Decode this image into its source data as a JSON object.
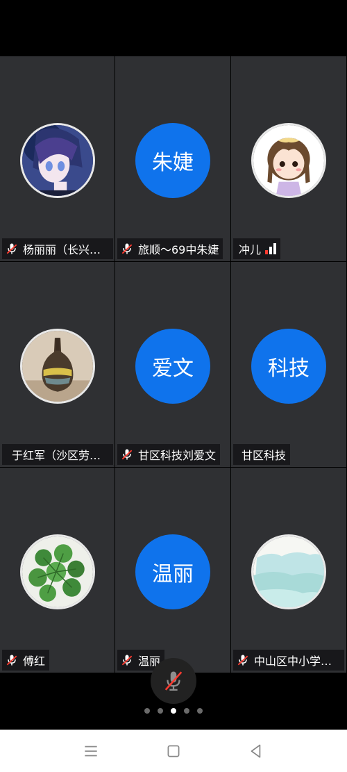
{
  "participants": [
    {
      "name": "杨丽丽（长兴岛…",
      "avatar_type": "photo",
      "avatar_icon": "anime-girl-avatar",
      "muted": true
    },
    {
      "name": "旅顺～69中朱婕",
      "avatar_type": "text",
      "avatar_text": "朱婕",
      "muted": true
    },
    {
      "name": "冲儿",
      "avatar_type": "photo",
      "avatar_icon": "cartoon-girl-avatar",
      "muted": false,
      "signal": true
    },
    {
      "name": "于红军（沙区劳技…",
      "avatar_type": "photo",
      "avatar_icon": "vase-avatar",
      "muted": false
    },
    {
      "name": "甘区科技刘爱文",
      "avatar_type": "text",
      "avatar_text": "爱文",
      "muted": true
    },
    {
      "name": "甘区科技",
      "avatar_type": "text",
      "avatar_text": "科技",
      "muted": false
    },
    {
      "name": "傅红",
      "avatar_type": "photo",
      "avatar_icon": "plant-avatar",
      "muted": true
    },
    {
      "name": "温丽",
      "avatar_type": "text",
      "avatar_text": "温丽",
      "muted": true
    },
    {
      "name": "中山区中小学实…",
      "avatar_type": "photo",
      "avatar_icon": "watercolor-avatar",
      "muted": true
    }
  ],
  "pagination": {
    "total": 5,
    "current": 3
  },
  "colors": {
    "accent": "#0f73ec",
    "tile": "#2f3033",
    "muted_red": "#ff3b30"
  },
  "nav": {
    "menu_icon": "menu-icon",
    "home_icon": "home-icon",
    "back_icon": "back-icon"
  }
}
